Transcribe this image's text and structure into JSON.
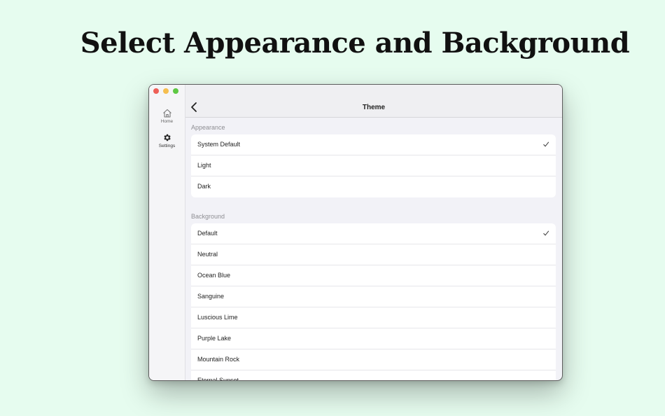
{
  "headline": "Select Appearance and Background",
  "sidebar": {
    "items": [
      {
        "label": "Home",
        "icon": "home-icon"
      },
      {
        "label": "Settings",
        "icon": "gear-icon"
      }
    ]
  },
  "header": {
    "title": "Theme"
  },
  "appearance": {
    "label": "Appearance",
    "options": [
      "System Default",
      "Light",
      "Dark"
    ],
    "selected": "System Default"
  },
  "background": {
    "label": "Background",
    "options": [
      "Default",
      "Neutral",
      "Ocean Blue",
      "Sanguine",
      "Luscious Lime",
      "Purple Lake",
      "Mountain Rock",
      "Eternal Sunset"
    ],
    "selected": "Default"
  },
  "colors": {
    "page_bg": "#e6fcef",
    "window_bg": "#f2f2f7",
    "traffic_red": "#ee5f57",
    "traffic_yellow": "#f5be4f",
    "traffic_green": "#5ec843"
  }
}
